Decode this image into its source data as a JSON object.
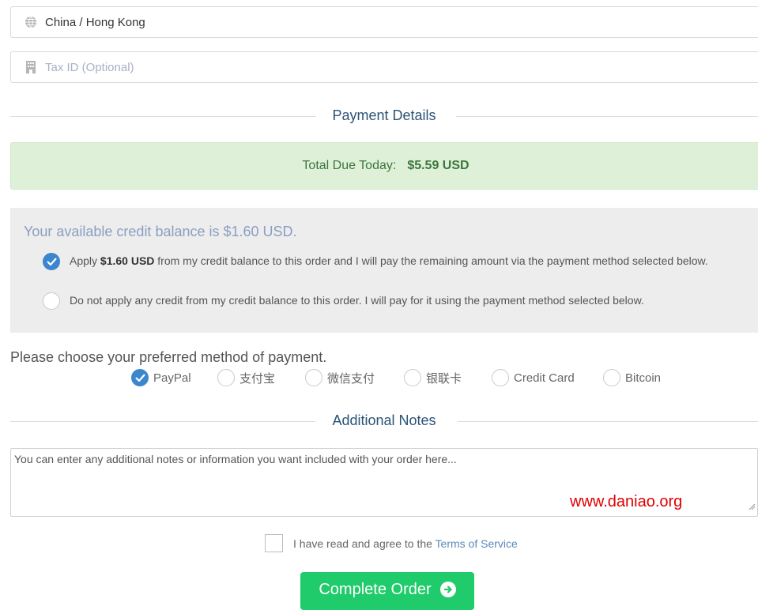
{
  "country_field": {
    "value": "China / Hong Kong",
    "icon": "globe-icon"
  },
  "tax_field": {
    "placeholder": "Tax ID (Optional)",
    "icon": "building-icon"
  },
  "payment_details": {
    "title": "Payment Details"
  },
  "total": {
    "label": "Total Due Today:",
    "amount": "$5.59 USD"
  },
  "credit": {
    "heading": "Your available credit balance is $1.60 USD.",
    "apply_prefix": "Apply ",
    "apply_amount": "$1.60 USD",
    "apply_suffix": " from my credit balance to this order and I will pay the remaining amount via the payment method selected below.",
    "apply_checked": true,
    "no_apply_text": "Do not apply any credit from my credit balance to this order. I will pay for it using the payment method selected below.",
    "no_apply_checked": false
  },
  "payment_methods": {
    "label": "Please choose your preferred method of payment.",
    "options": [
      {
        "label": "PayPal",
        "checked": true
      },
      {
        "label": "支付宝",
        "checked": false
      },
      {
        "label": "微信支付",
        "checked": false
      },
      {
        "label": "银联卡",
        "checked": false
      },
      {
        "label": "Credit Card",
        "checked": false
      },
      {
        "label": "Bitcoin",
        "checked": false
      }
    ]
  },
  "additional_notes": {
    "title": "Additional Notes",
    "placeholder": "You can enter any additional notes or information you want included with your order here..."
  },
  "watermark": "www.daniao.org",
  "tos": {
    "prefix": "I have read and agree to the ",
    "link": "Terms of Service",
    "checked": false
  },
  "complete_button": {
    "label": "Complete Order"
  },
  "colors": {
    "accent": "#3a86cf",
    "success_bg": "#dff0d8",
    "button": "#1fcb6a",
    "heading": "#2b5376"
  }
}
